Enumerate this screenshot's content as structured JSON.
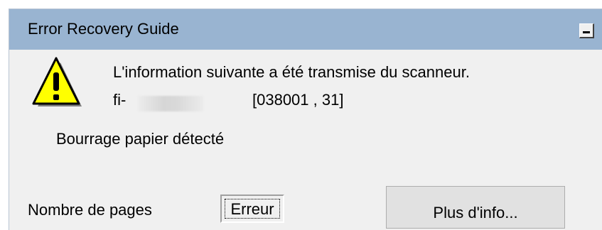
{
  "window": {
    "title": "Error Recovery Guide",
    "minimize_icon": "minimize-icon"
  },
  "message": {
    "icon": "warning-icon",
    "line1": "L'information suivante a été transmise du scanneur.",
    "model_prefix": "fi-",
    "code": "[038001 , 31]",
    "error_description": "Bourrage papier détecté"
  },
  "footer": {
    "pages_label": "Nombre de pages",
    "pages_value": "Erreur",
    "more_info_button": "Plus d'info..."
  },
  "colors": {
    "titlebar": "#99b4d1",
    "window_background": "#f0f0f0",
    "warning_fill": "#ffff00"
  }
}
